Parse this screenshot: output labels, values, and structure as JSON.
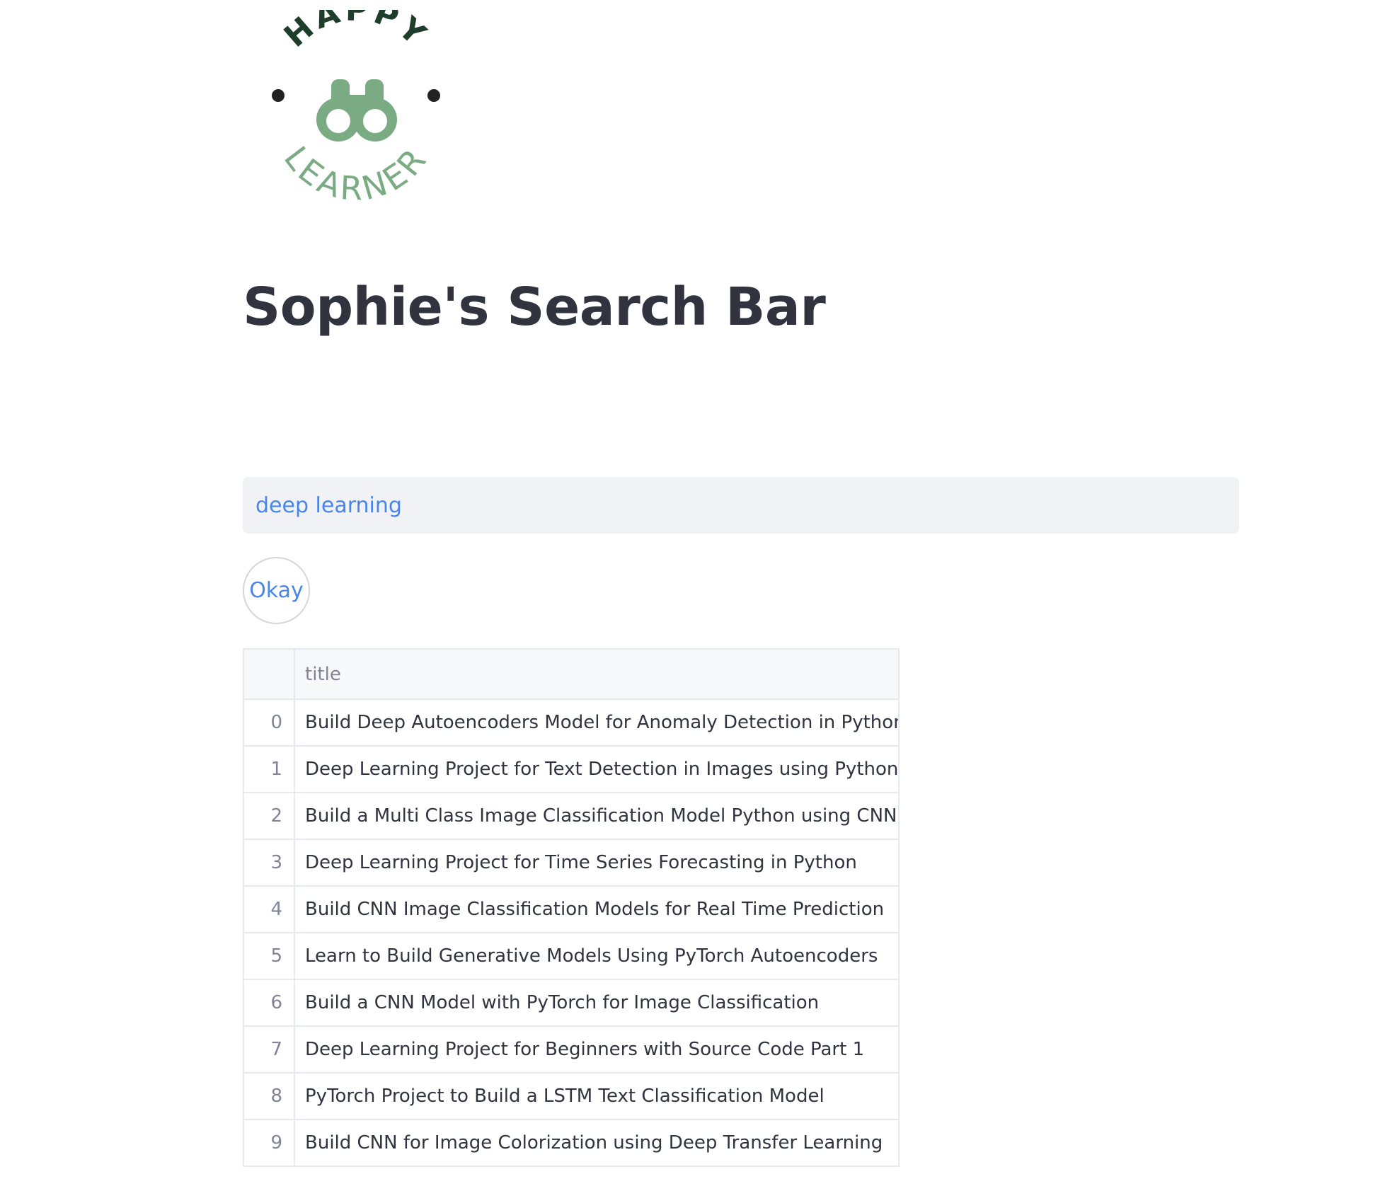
{
  "logo": {
    "top_text": "HAPPY",
    "bottom_text": "LEARNER",
    "icon": "binoculars-icon",
    "colors": {
      "dark": "#1f3d2b",
      "green": "#7aab82"
    }
  },
  "page": {
    "title": "Sophie's Search Bar"
  },
  "search": {
    "value": "deep learning"
  },
  "okay_button": {
    "label": "Okay"
  },
  "colors": {
    "accent": "#4a86e8",
    "text": "#31333f",
    "muted": "#808495"
  },
  "results": {
    "columns": [
      "",
      "title"
    ],
    "rows": [
      {
        "index": "0",
        "title": "Build Deep Autoencoders Model for Anomaly Detection in Python"
      },
      {
        "index": "1",
        "title": "Deep Learning Project for Text Detection in Images using Python"
      },
      {
        "index": "2",
        "title": "Build a Multi Class Image Classification Model Python using CNN"
      },
      {
        "index": "3",
        "title": "Deep Learning Project for Time Series Forecasting in Python"
      },
      {
        "index": "4",
        "title": "Build CNN Image Classification Models for Real Time Prediction"
      },
      {
        "index": "5",
        "title": "Learn to Build Generative Models Using PyTorch Autoencoders"
      },
      {
        "index": "6",
        "title": "Build a CNN Model with PyTorch for Image Classification"
      },
      {
        "index": "7",
        "title": "Deep Learning Project for Beginners with Source Code Part 1"
      },
      {
        "index": "8",
        "title": "PyTorch Project to Build a LSTM Text Classification Model"
      },
      {
        "index": "9",
        "title": "Build CNN for Image Colorization using Deep Transfer Learning"
      }
    ]
  }
}
